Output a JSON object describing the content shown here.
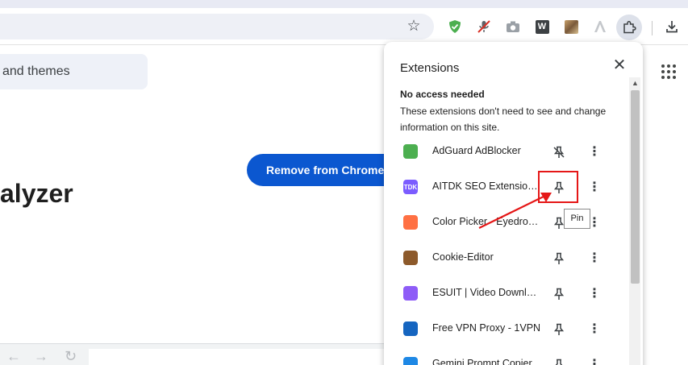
{
  "browser": {
    "toolbar_icons": [
      "star-icon",
      "adguard-icon",
      "muted-mic-icon",
      "camera-icon",
      "w-icon",
      "image-icon",
      "a-logo-icon",
      "puzzle-icon",
      "download-icon"
    ]
  },
  "page": {
    "search_text": "and themes",
    "remove_button": "Remove from Chrome",
    "title_fragment": "alyzer"
  },
  "panel": {
    "title": "Extensions",
    "section_title": "No access needed",
    "section_desc": "These extensions don't need to see and change information on this site.",
    "tooltip": "Pin",
    "extensions": [
      {
        "name": "AdGuard AdBlocker",
        "pinned": true,
        "logo_color": "#4caf50"
      },
      {
        "name": "AITDK SEO Extension -...",
        "pinned": false,
        "logo_color": "#7b5cff",
        "logo_text": "TDK"
      },
      {
        "name": "Color Picker - Eyedropp...",
        "pinned": false,
        "logo_color": "#ff7043"
      },
      {
        "name": "Cookie-Editor",
        "pinned": false,
        "logo_color": "#8d5a2b"
      },
      {
        "name": "ESUIT | Video Downloa...",
        "pinned": false,
        "logo_color": "#8e5cf7"
      },
      {
        "name": "Free VPN Proxy - 1VPN",
        "pinned": false,
        "logo_color": "#1565c0"
      },
      {
        "name": "Gemini Prompt Copier",
        "pinned": false,
        "logo_color": "#1e88e5"
      }
    ]
  },
  "annotation": {
    "highlight_color": "#e51717"
  }
}
